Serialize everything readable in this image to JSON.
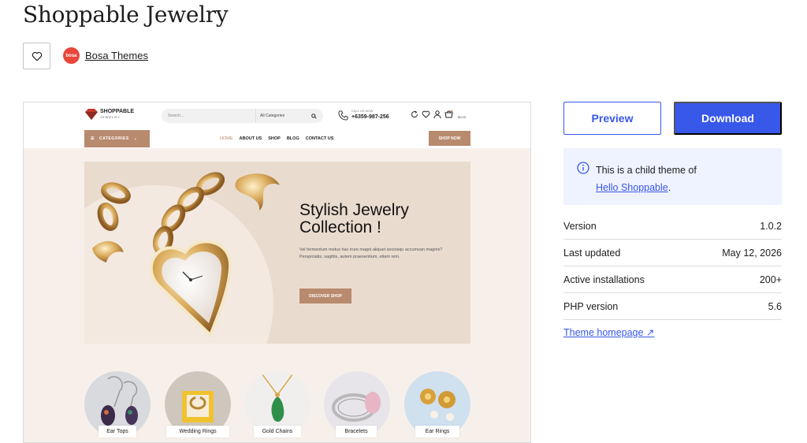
{
  "page": {
    "title": "Shoppable Jewelry"
  },
  "author": {
    "avatar_text": "bosa",
    "name": "Bosa Themes"
  },
  "actions": {
    "preview_label": "Preview",
    "download_label": "Download"
  },
  "notice": {
    "text": "This is a child theme of",
    "link": "Hello Shoppable",
    "suffix": "."
  },
  "meta": [
    {
      "label": "Version",
      "value": "1.0.2"
    },
    {
      "label": "Last updated",
      "value": "May 12, 2026"
    },
    {
      "label": "Active installations",
      "value": "200+"
    },
    {
      "label": "PHP version",
      "value": "5.6"
    }
  ],
  "homepage_link": "Theme homepage ↗",
  "screenshot": {
    "logo_text": "SHOPPABLE",
    "logo_sub": "JEWELRY",
    "search_placeholder": "Search...",
    "category_select": "All Categories",
    "call_label": "CALL US NOW",
    "phone": "+6359-987-256",
    "cart_total": "$0.00",
    "categories_label": "CATEGORIES",
    "nav": [
      "HOME",
      "ABOUT US",
      "SHOP",
      "BLOG",
      "CONTACT US"
    ],
    "shop_now": "SHOP NOW",
    "hero_title": "Stylish Jewelry Collection !",
    "hero_text": "Vel fermentum metus hac irure magni aliquet sociosqu accumsan magnis? Perspiciatis, sagittis, autem praesentium, etiam rem.",
    "hero_button": "DISCOVER SHOP",
    "categories": [
      "Ear Tops",
      "Wedding Rings",
      "Gold Chains",
      "Bracelets",
      "Ear Rings"
    ]
  },
  "colors": {
    "accent": "#3858e9",
    "brand": "#b88a6e",
    "notice_bg": "#eff2ff",
    "hero_bg": "#eadbcf"
  }
}
